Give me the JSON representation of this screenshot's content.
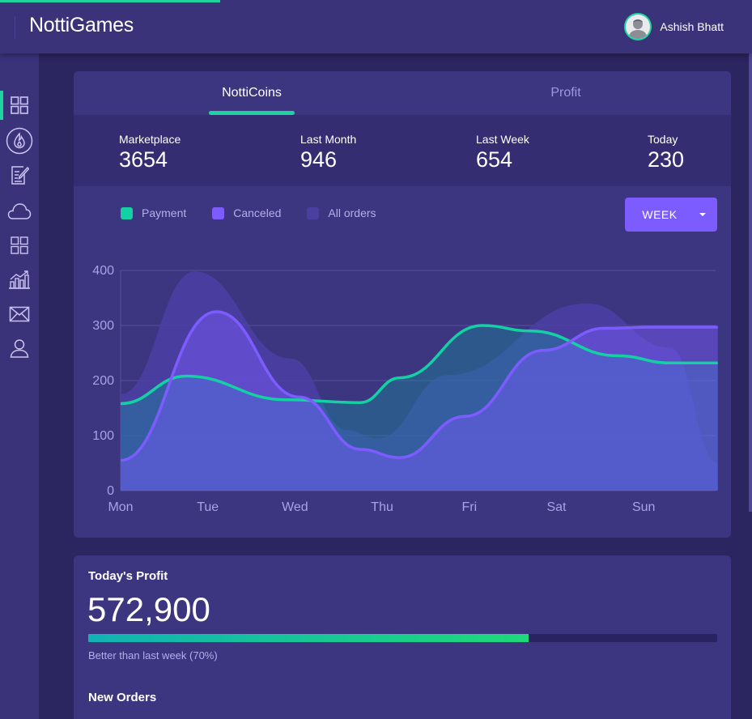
{
  "app": {
    "brand": "NottiGames"
  },
  "user": {
    "name": "Ashish Bhatt"
  },
  "sidebar": {
    "items": [
      {
        "name": "dashboard",
        "icon": "grid-icon",
        "active": true
      },
      {
        "name": "trending",
        "icon": "flame-icon"
      },
      {
        "name": "notes",
        "icon": "edit-icon"
      },
      {
        "name": "cloud",
        "icon": "cloud-icon"
      },
      {
        "name": "apps",
        "icon": "grid-icon"
      },
      {
        "name": "analytics",
        "icon": "bar-chart-icon"
      },
      {
        "name": "messages",
        "icon": "mail-icon"
      },
      {
        "name": "profile",
        "icon": "user-icon"
      }
    ]
  },
  "tabs": [
    {
      "label": "NottiCoins",
      "active": true
    },
    {
      "label": "Profit",
      "active": false
    }
  ],
  "stats": [
    {
      "label": "Marketplace",
      "value": "3654"
    },
    {
      "label": "Last Month",
      "value": "946"
    },
    {
      "label": "Last Week",
      "value": "654"
    },
    {
      "label": "Today",
      "value": "230"
    }
  ],
  "period_button": {
    "label": "WEEK"
  },
  "colors": {
    "accent": "#1fd3a0",
    "payment": "#13d1a3",
    "canceled": "#7d5cff",
    "all_orders": "#4a3fa0",
    "card": "#3c3580",
    "background": "#2b2560"
  },
  "chart_data": {
    "type": "area",
    "categories": [
      "Mon",
      "Tue",
      "Wed",
      "Thu",
      "Fri",
      "Sat",
      "Sun"
    ],
    "ylim": [
      0,
      400
    ],
    "yticks": [
      0,
      100,
      200,
      300,
      400
    ],
    "grid": true,
    "legend_position": "top-left",
    "series": [
      {
        "name": "Payment",
        "color": "#13d1a3",
        "values": [
          158,
          208,
          165,
          160,
          205,
          300,
          290,
          245,
          232,
          232
        ],
        "x": [
          0,
          0.75,
          1.9,
          2.75,
          3.2,
          4.15,
          4.7,
          5.7,
          6.3,
          6.85
        ]
      },
      {
        "name": "Canceled",
        "color": "#7d5cff",
        "values": [
          55,
          325,
          170,
          75,
          60,
          135,
          255,
          295,
          297,
          297
        ],
        "x": [
          0,
          1.1,
          2.05,
          2.75,
          3.2,
          3.95,
          4.85,
          5.55,
          6.15,
          6.85
        ]
      },
      {
        "name": "All orders",
        "color": "#4a3fa0",
        "values": [
          175,
          398,
          240,
          110,
          95,
          210,
          340,
          260,
          50
        ],
        "x": [
          0,
          0.85,
          1.95,
          2.6,
          2.95,
          3.75,
          5.35,
          6.3,
          6.85
        ]
      }
    ]
  },
  "profit": {
    "title": "Today's Profit",
    "value": "572,900",
    "progress": 0.7,
    "note": "Better than last week (70%)"
  },
  "orders": {
    "title": "New Orders"
  }
}
